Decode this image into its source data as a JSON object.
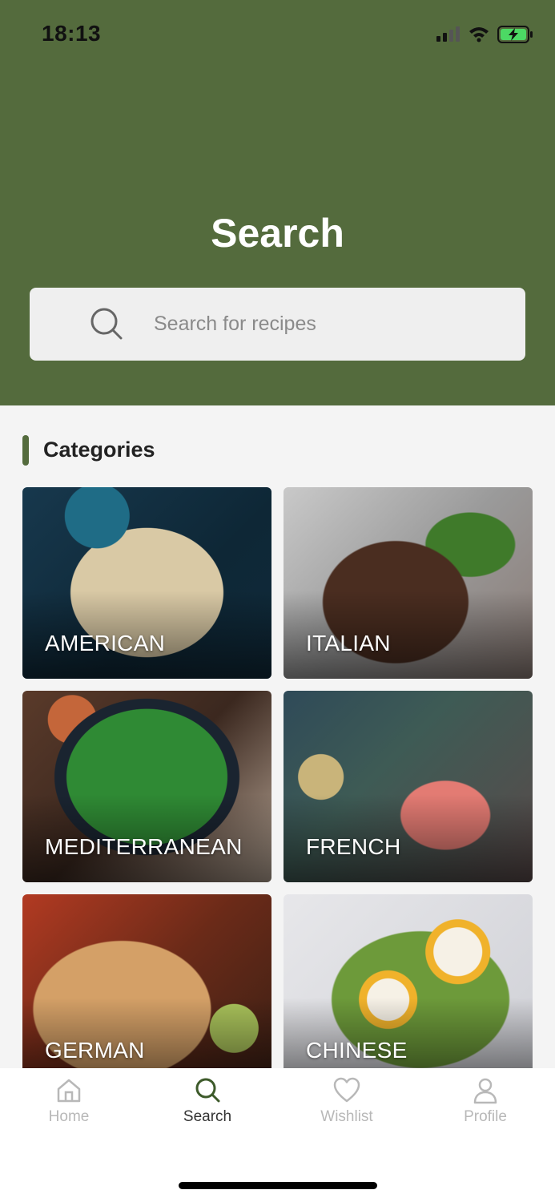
{
  "status_bar": {
    "time": "18:13"
  },
  "header": {
    "title": "Search"
  },
  "search": {
    "placeholder": "Search for recipes",
    "value": ""
  },
  "categories": {
    "title": "Categories",
    "items": [
      {
        "label": "AMERICAN"
      },
      {
        "label": "ITALIAN"
      },
      {
        "label": "MEDITERRANEAN"
      },
      {
        "label": "FRENCH"
      },
      {
        "label": "GERMAN"
      },
      {
        "label": "CHINESE"
      }
    ]
  },
  "tabbar": {
    "items": [
      {
        "label": "Home",
        "icon": "home-icon",
        "active": false
      },
      {
        "label": "Search",
        "icon": "search-icon",
        "active": true
      },
      {
        "label": "Wishlist",
        "icon": "heart-icon",
        "active": false
      },
      {
        "label": "Profile",
        "icon": "user-icon",
        "active": false
      }
    ]
  },
  "colors": {
    "brand": "#546b3d",
    "background": "#f4f4f4",
    "inactive_tab": "#b8b8b8",
    "active_tab": "#333333"
  }
}
